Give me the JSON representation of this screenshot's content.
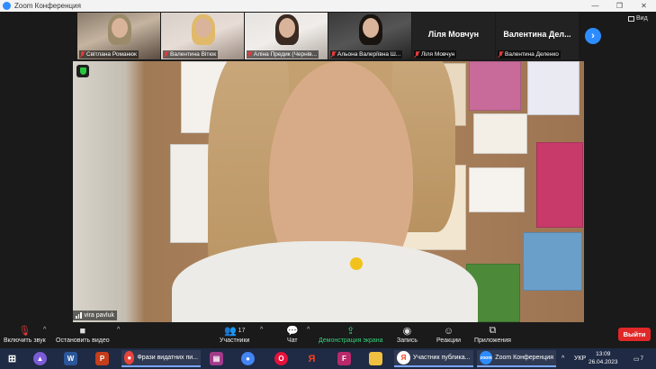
{
  "window": {
    "title": "Zoom Конференция"
  },
  "gallery": {
    "tiles": [
      {
        "name": "Світлана Романюк",
        "kind": "video"
      },
      {
        "name": "Валентина Вітюк",
        "kind": "video"
      },
      {
        "name": "Аліна Предик (Чернів...",
        "kind": "video"
      },
      {
        "name": "Альона Валеріївна Ш...",
        "kind": "video"
      },
      {
        "name": "Ліля Мовчун",
        "display": "Ліля Мовчун",
        "kind": "name"
      },
      {
        "name": "Валентина Деленко",
        "display": "Валентина  Дел...",
        "kind": "name"
      }
    ],
    "view_label": "Вид"
  },
  "speaker": {
    "name": "vira pavluk"
  },
  "toolbar": {
    "audio": "Включить звук",
    "video": "Остановить видео",
    "participants": "Участники",
    "participants_count": "17",
    "chat": "Чат",
    "share": "Демонстрация экрана",
    "record": "Запись",
    "reactions": "Реакции",
    "apps": "Приложения",
    "exit": "Выйти"
  },
  "taskbar": {
    "chrome_tab": "Фрази видатних пи...",
    "yandex_tab": "Участник публика...",
    "zoom_tab": "Zoom Конференция",
    "lang": "УКР",
    "time": "13:09",
    "date": "26.04.2023",
    "notifications": "7"
  },
  "colors": {
    "accent": "#2d8cff",
    "exit": "#e02828",
    "share": "#33d17a",
    "taskbar": "#1f2a44"
  }
}
